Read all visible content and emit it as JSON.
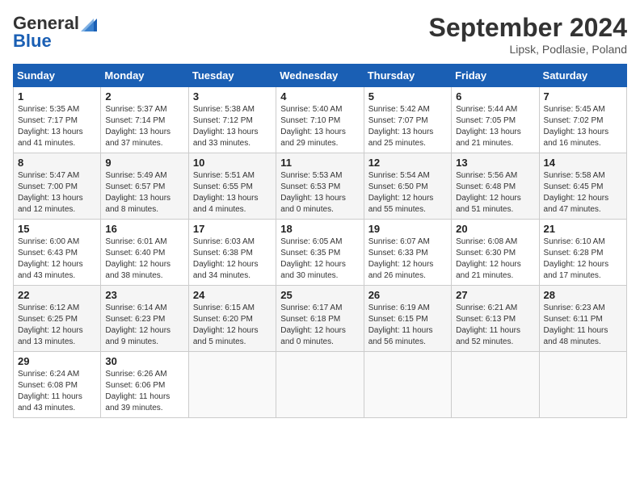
{
  "header": {
    "logo_general": "General",
    "logo_blue": "Blue",
    "month_title": "September 2024",
    "location": "Lipsk, Podlasie, Poland"
  },
  "days_of_week": [
    "Sunday",
    "Monday",
    "Tuesday",
    "Wednesday",
    "Thursday",
    "Friday",
    "Saturday"
  ],
  "weeks": [
    [
      {
        "day": "1",
        "info": "Sunrise: 5:35 AM\nSunset: 7:17 PM\nDaylight: 13 hours\nand 41 minutes."
      },
      {
        "day": "2",
        "info": "Sunrise: 5:37 AM\nSunset: 7:14 PM\nDaylight: 13 hours\nand 37 minutes."
      },
      {
        "day": "3",
        "info": "Sunrise: 5:38 AM\nSunset: 7:12 PM\nDaylight: 13 hours\nand 33 minutes."
      },
      {
        "day": "4",
        "info": "Sunrise: 5:40 AM\nSunset: 7:10 PM\nDaylight: 13 hours\nand 29 minutes."
      },
      {
        "day": "5",
        "info": "Sunrise: 5:42 AM\nSunset: 7:07 PM\nDaylight: 13 hours\nand 25 minutes."
      },
      {
        "day": "6",
        "info": "Sunrise: 5:44 AM\nSunset: 7:05 PM\nDaylight: 13 hours\nand 21 minutes."
      },
      {
        "day": "7",
        "info": "Sunrise: 5:45 AM\nSunset: 7:02 PM\nDaylight: 13 hours\nand 16 minutes."
      }
    ],
    [
      {
        "day": "8",
        "info": "Sunrise: 5:47 AM\nSunset: 7:00 PM\nDaylight: 13 hours\nand 12 minutes."
      },
      {
        "day": "9",
        "info": "Sunrise: 5:49 AM\nSunset: 6:57 PM\nDaylight: 13 hours\nand 8 minutes."
      },
      {
        "day": "10",
        "info": "Sunrise: 5:51 AM\nSunset: 6:55 PM\nDaylight: 13 hours\nand 4 minutes."
      },
      {
        "day": "11",
        "info": "Sunrise: 5:53 AM\nSunset: 6:53 PM\nDaylight: 13 hours\nand 0 minutes."
      },
      {
        "day": "12",
        "info": "Sunrise: 5:54 AM\nSunset: 6:50 PM\nDaylight: 12 hours\nand 55 minutes."
      },
      {
        "day": "13",
        "info": "Sunrise: 5:56 AM\nSunset: 6:48 PM\nDaylight: 12 hours\nand 51 minutes."
      },
      {
        "day": "14",
        "info": "Sunrise: 5:58 AM\nSunset: 6:45 PM\nDaylight: 12 hours\nand 47 minutes."
      }
    ],
    [
      {
        "day": "15",
        "info": "Sunrise: 6:00 AM\nSunset: 6:43 PM\nDaylight: 12 hours\nand 43 minutes."
      },
      {
        "day": "16",
        "info": "Sunrise: 6:01 AM\nSunset: 6:40 PM\nDaylight: 12 hours\nand 38 minutes."
      },
      {
        "day": "17",
        "info": "Sunrise: 6:03 AM\nSunset: 6:38 PM\nDaylight: 12 hours\nand 34 minutes."
      },
      {
        "day": "18",
        "info": "Sunrise: 6:05 AM\nSunset: 6:35 PM\nDaylight: 12 hours\nand 30 minutes."
      },
      {
        "day": "19",
        "info": "Sunrise: 6:07 AM\nSunset: 6:33 PM\nDaylight: 12 hours\nand 26 minutes."
      },
      {
        "day": "20",
        "info": "Sunrise: 6:08 AM\nSunset: 6:30 PM\nDaylight: 12 hours\nand 21 minutes."
      },
      {
        "day": "21",
        "info": "Sunrise: 6:10 AM\nSunset: 6:28 PM\nDaylight: 12 hours\nand 17 minutes."
      }
    ],
    [
      {
        "day": "22",
        "info": "Sunrise: 6:12 AM\nSunset: 6:25 PM\nDaylight: 12 hours\nand 13 minutes."
      },
      {
        "day": "23",
        "info": "Sunrise: 6:14 AM\nSunset: 6:23 PM\nDaylight: 12 hours\nand 9 minutes."
      },
      {
        "day": "24",
        "info": "Sunrise: 6:15 AM\nSunset: 6:20 PM\nDaylight: 12 hours\nand 5 minutes."
      },
      {
        "day": "25",
        "info": "Sunrise: 6:17 AM\nSunset: 6:18 PM\nDaylight: 12 hours\nand 0 minutes."
      },
      {
        "day": "26",
        "info": "Sunrise: 6:19 AM\nSunset: 6:15 PM\nDaylight: 11 hours\nand 56 minutes."
      },
      {
        "day": "27",
        "info": "Sunrise: 6:21 AM\nSunset: 6:13 PM\nDaylight: 11 hours\nand 52 minutes."
      },
      {
        "day": "28",
        "info": "Sunrise: 6:23 AM\nSunset: 6:11 PM\nDaylight: 11 hours\nand 48 minutes."
      }
    ],
    [
      {
        "day": "29",
        "info": "Sunrise: 6:24 AM\nSunset: 6:08 PM\nDaylight: 11 hours\nand 43 minutes."
      },
      {
        "day": "30",
        "info": "Sunrise: 6:26 AM\nSunset: 6:06 PM\nDaylight: 11 hours\nand 39 minutes."
      },
      {
        "day": "",
        "info": ""
      },
      {
        "day": "",
        "info": ""
      },
      {
        "day": "",
        "info": ""
      },
      {
        "day": "",
        "info": ""
      },
      {
        "day": "",
        "info": ""
      }
    ]
  ]
}
